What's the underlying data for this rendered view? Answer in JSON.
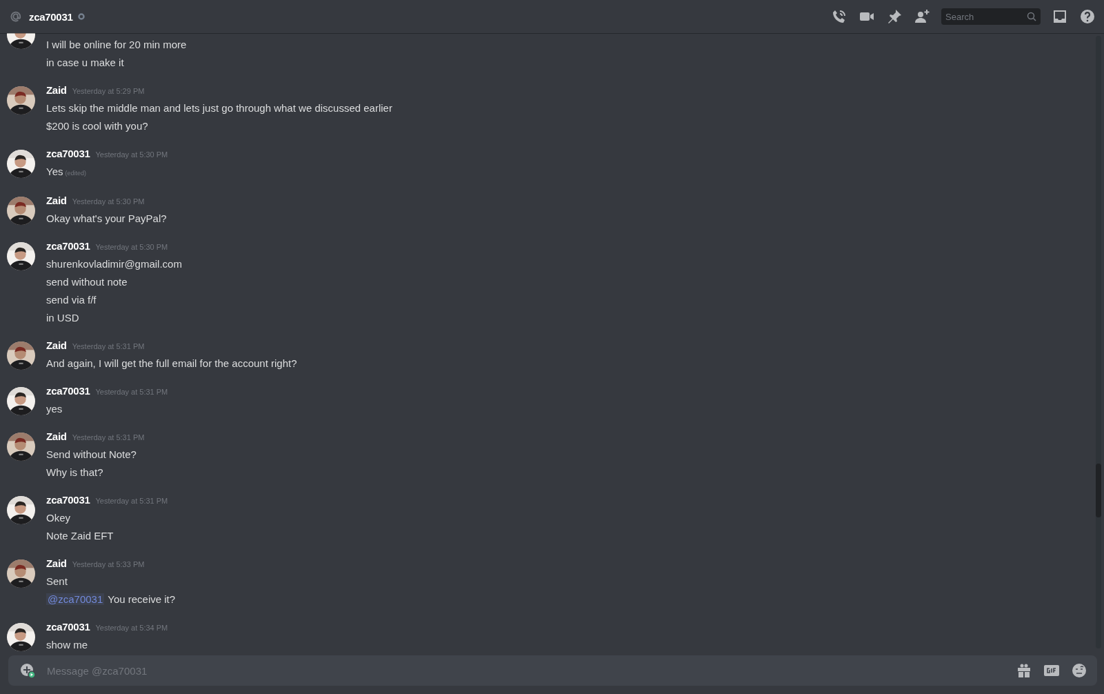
{
  "header": {
    "title": "zca70031"
  },
  "toolbar": {
    "search": {
      "placeholder": "Search"
    }
  },
  "messages": [
    {
      "lines": [
        {
          "text": "I will be online for 20 min more"
        },
        {
          "text": "in case u make it"
        }
      ]
    },
    {
      "author": "Zaid",
      "time": "Yesterday at 5:29 PM",
      "lines": [
        {
          "text": "Lets skip the middle man and lets just go through what we discussed earlier"
        },
        {
          "text": "$200 is cool with you?"
        }
      ]
    },
    {
      "author": "zca70031",
      "time": "Yesterday at 5:30 PM",
      "lines": [
        {
          "text": "Yes",
          "edited": "(edited)"
        }
      ]
    },
    {
      "author": "Zaid",
      "time": "Yesterday at 5:30 PM",
      "lines": [
        {
          "text": "Okay what's your PayPal?"
        }
      ]
    },
    {
      "author": "zca70031",
      "time": "Yesterday at 5:30 PM",
      "lines": [
        {
          "text": "shurenkovladimir@gmail.com"
        },
        {
          "text": "send without note"
        },
        {
          "text": "send via f/f"
        },
        {
          "text": "in USD"
        }
      ]
    },
    {
      "author": "Zaid",
      "time": "Yesterday at 5:31 PM",
      "lines": [
        {
          "text": "And again, I will get the full email for the account right?"
        }
      ]
    },
    {
      "author": "zca70031",
      "time": "Yesterday at 5:31 PM",
      "lines": [
        {
          "text": "yes"
        }
      ]
    },
    {
      "author": "Zaid",
      "time": "Yesterday at 5:31 PM",
      "lines": [
        {
          "text": "Send without Note?"
        },
        {
          "text": "Why is that?"
        }
      ]
    },
    {
      "author": "zca70031",
      "time": "Yesterday at 5:31 PM",
      "lines": [
        {
          "text": "Okey"
        },
        {
          "text": "Note Zaid EFT"
        }
      ]
    },
    {
      "author": "Zaid",
      "time": "Yesterday at 5:33 PM",
      "lines": [
        {
          "text": "Sent"
        },
        {
          "mention": "@zca70031",
          "text": "You receive it?"
        }
      ]
    },
    {
      "author": "zca70031",
      "time": "Yesterday at 5:34 PM",
      "lines": [
        {
          "text": "show me"
        }
      ]
    }
  ],
  "composer": {
    "placeholder": "Message @zca70031"
  }
}
